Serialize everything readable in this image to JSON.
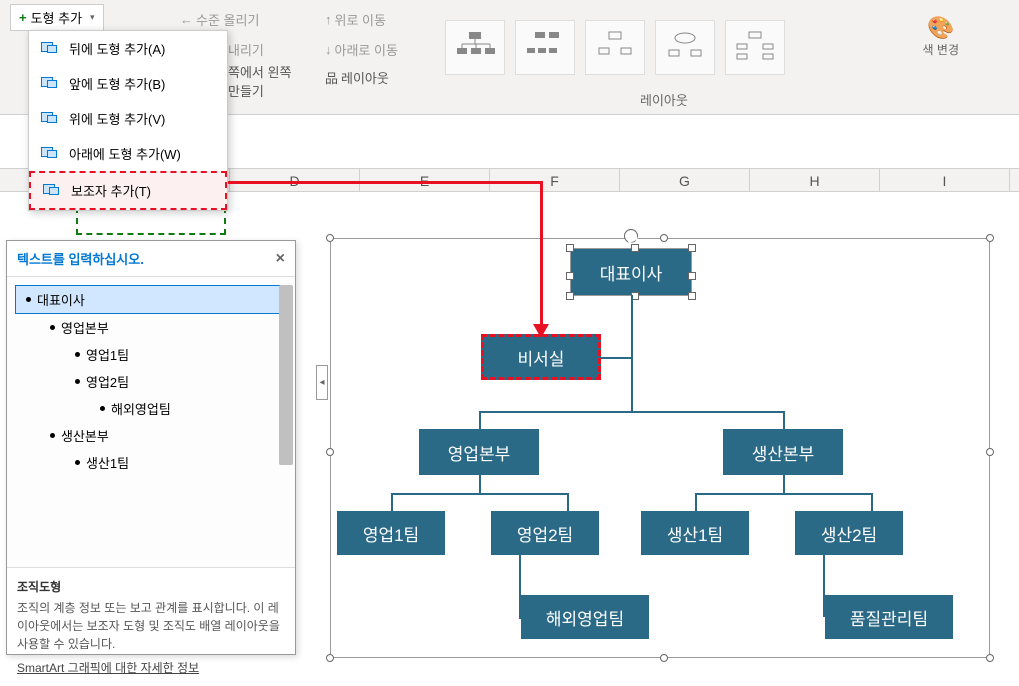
{
  "ribbon": {
    "add_shape_label": "도형 추가",
    "level_up": "수준 올리기",
    "level_down": "내리기",
    "move_up": "위로 이동",
    "move_down": "아래로 이동",
    "rtl_label": "쪽에서 왼쪽\n만들기",
    "layout_label": "레이아웃",
    "layout_section": "레이아웃",
    "color_change": "색 변경"
  },
  "dropdown": {
    "items": [
      "뒤에 도형 추가(A)",
      "앞에 도형 추가(B)",
      "위에 도형 추가(V)",
      "아래에 도형 추가(W)",
      "보조자 추가(T)"
    ]
  },
  "columns": [
    "D",
    "E",
    "F",
    "G",
    "H",
    "I"
  ],
  "text_pane": {
    "header": "텍스트를 입력하십시오.",
    "items": [
      {
        "label": "대표이사",
        "level": 0,
        "selected": true
      },
      {
        "label": "영업본부",
        "level": 1
      },
      {
        "label": "영업1팀",
        "level": 2
      },
      {
        "label": "영업2팀",
        "level": 2
      },
      {
        "label": "해외영업팀",
        "level": 3
      },
      {
        "label": "생산본부",
        "level": 1
      },
      {
        "label": "생산1팀",
        "level": 2
      }
    ],
    "footer_title": "조직도형",
    "footer_desc": "조직의 계층 정보 또는 보고 관계를 표시합니다. 이 레이아웃에서는 보조자 도형 및 조직도 배열 레이아웃을 사용할 수 있습니다.",
    "footer_link": "SmartArt 그래픽에 대한 자세한 정보"
  },
  "org": {
    "ceo": "대표이사",
    "assistant": "비서실",
    "dept1": "영업본부",
    "dept2": "생산본부",
    "team1": "영업1팀",
    "team2": "영업2팀",
    "team3": "생산1팀",
    "team4": "생산2팀",
    "sub1": "해외영업팀",
    "sub2": "품질관리팀"
  }
}
